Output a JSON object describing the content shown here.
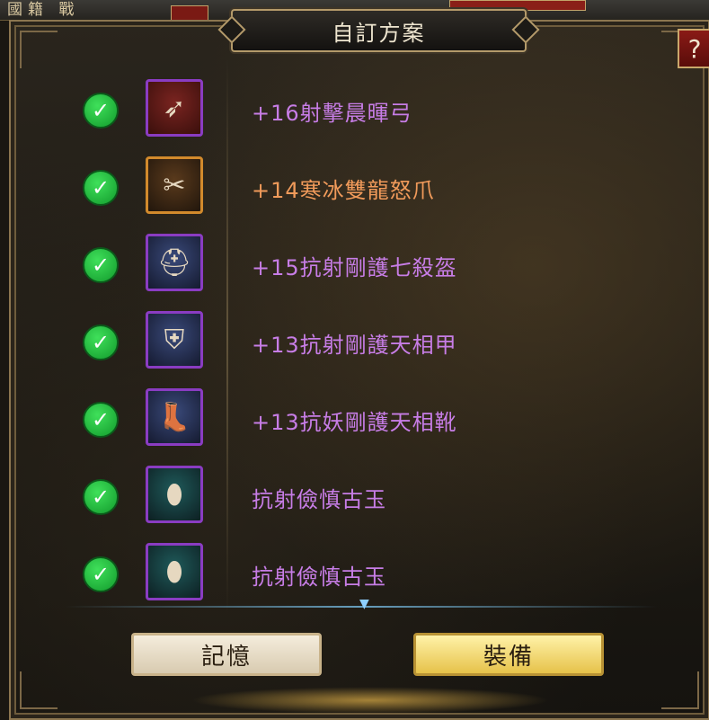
{
  "background": {
    "left_text": "國籍 戰"
  },
  "dialog": {
    "title": "自訂方案",
    "help_label": "?"
  },
  "items": [
    {
      "name": "+16射擊晨暉弓",
      "icon": "bow-icon",
      "color": "#c77de6",
      "frame": "red"
    },
    {
      "name": "+14寒冰雙龍怒爪",
      "icon": "claw-icon",
      "color": "#f09a5a",
      "frame": "orange"
    },
    {
      "name": "+15抗射剛護七殺盔",
      "icon": "helmet-icon",
      "color": "#c77de6",
      "frame": "blue"
    },
    {
      "name": "+13抗射剛護天相甲",
      "icon": "armor-icon",
      "color": "#c77de6",
      "frame": "blue"
    },
    {
      "name": "+13抗妖剛護天相靴",
      "icon": "boots-icon",
      "color": "#c77de6",
      "frame": "blue"
    },
    {
      "name": "抗射儉慎古玉",
      "icon": "jade-pendant-icon",
      "color": "#c77de6",
      "frame": "teal"
    },
    {
      "name": "抗射儉慎古玉",
      "icon": "jade-pendant-icon",
      "color": "#c77de6",
      "frame": "teal"
    }
  ],
  "buttons": {
    "memory_label": "記憶",
    "equip_label": "裝備"
  }
}
